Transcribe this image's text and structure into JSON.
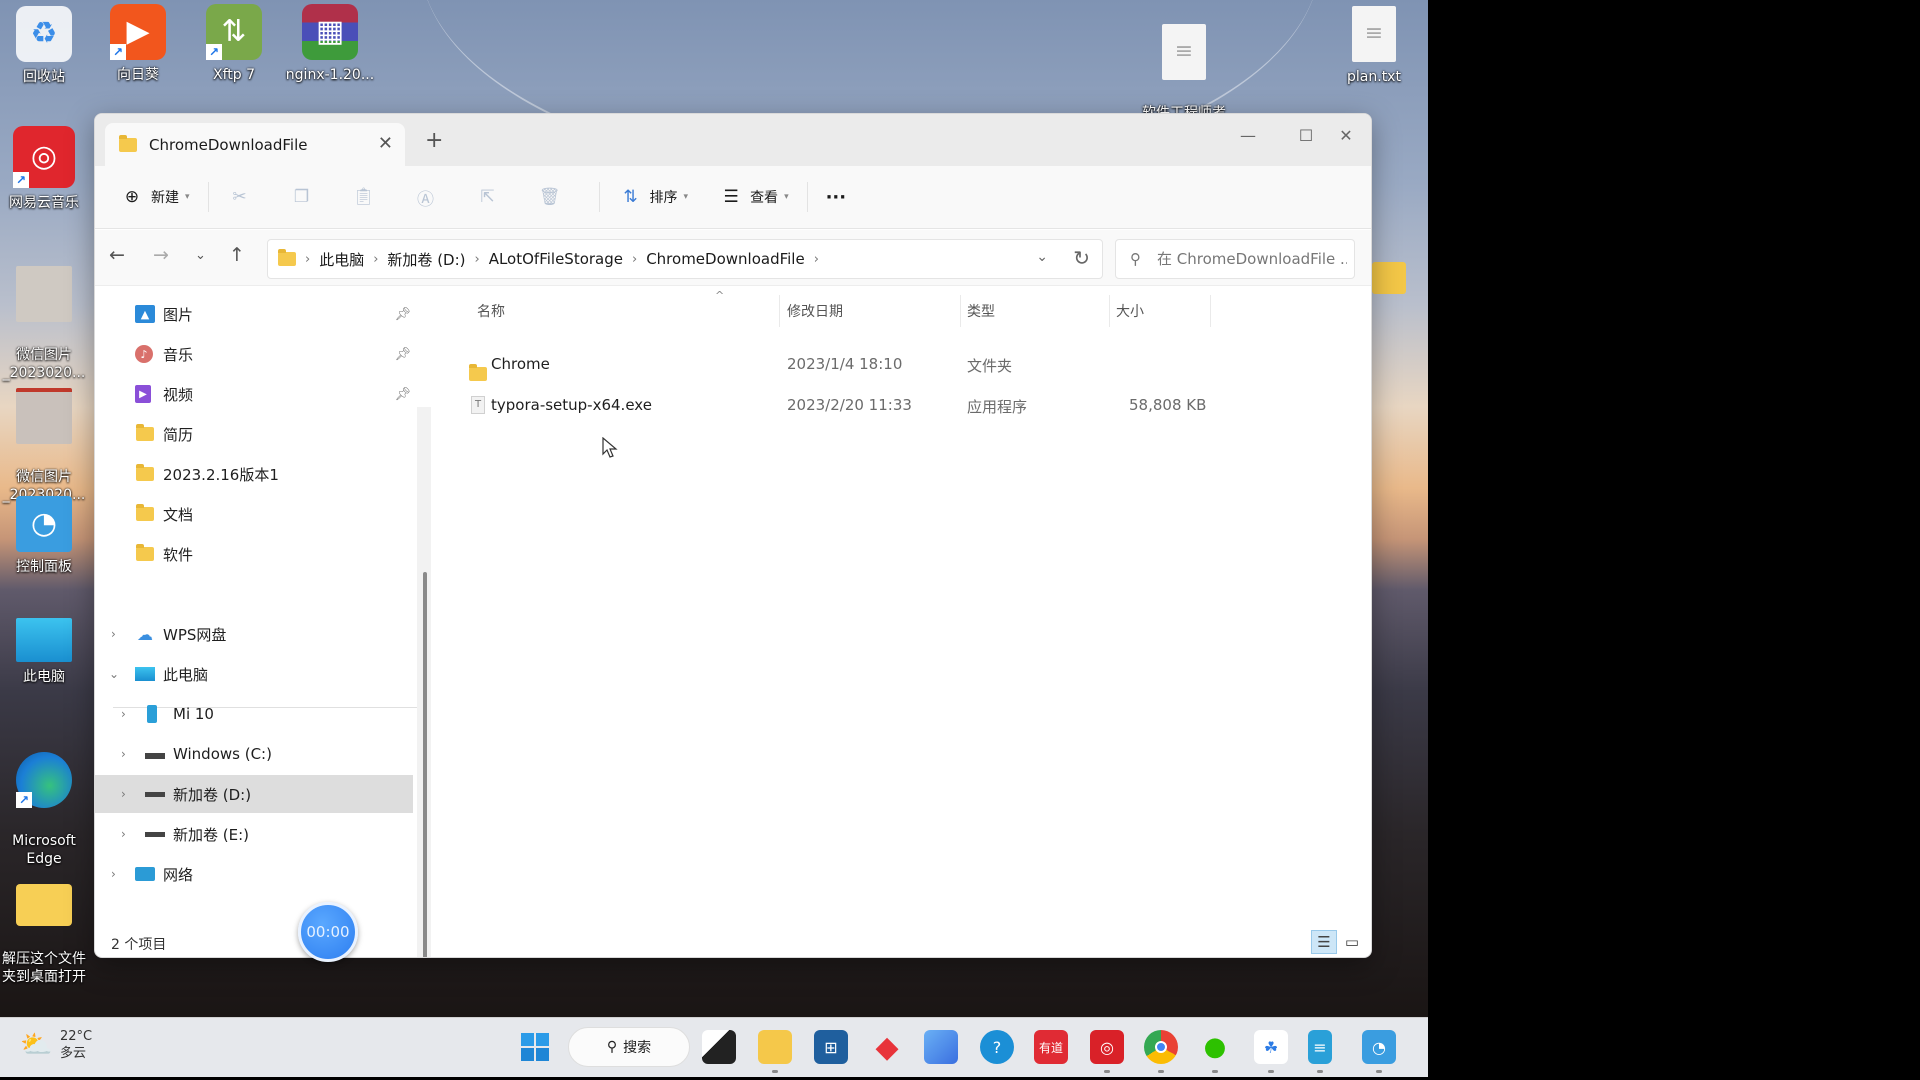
{
  "desktop": {
    "icons": [
      {
        "label": "回收站",
        "icon": "recycle-bin"
      },
      {
        "label": "向日葵",
        "icon": "sunlogin"
      },
      {
        "label": "Xftp 7",
        "icon": "xftp"
      },
      {
        "label": "nginx-1.20...",
        "icon": "winrar-archive"
      },
      {
        "label": "软件工程师考\n取证书.txt",
        "icon": "text-file"
      },
      {
        "label": "plan.txt",
        "icon": "text-file"
      },
      {
        "label": "网易云音乐",
        "icon": "netease-music"
      },
      {
        "label": "微信图片\n_2023020...",
        "icon": "image-file"
      },
      {
        "label": "微信图片\n_2023020...",
        "icon": "image-file"
      },
      {
        "label": "控制面板",
        "icon": "control-panel"
      },
      {
        "label": "此电脑",
        "icon": "this-pc"
      },
      {
        "label": "Microsoft\nEdge",
        "icon": "edge"
      },
      {
        "label": "解压这个文件\n夹到桌面打开",
        "icon": "folder"
      }
    ]
  },
  "window": {
    "tab_title": "ChromeDownloadFile",
    "new_tab": "+",
    "close_tab": "✕",
    "controls": {
      "minimize": "—",
      "maximize": "☐",
      "close": "✕"
    }
  },
  "toolbar": {
    "new_label": "新建",
    "sort_label": "排序",
    "view_label": "查看",
    "more_label": "···"
  },
  "address": {
    "crumbs": [
      "此电脑",
      "新加卷 (D:)",
      "ALotOfFileStorage",
      "ChromeDownloadFile"
    ],
    "search_placeholder": "在 ChromeDownloadFile ..."
  },
  "sidebar": {
    "quick_access": [
      {
        "label": "图片",
        "icon": "pictures",
        "pinned": true
      },
      {
        "label": "音乐",
        "icon": "music",
        "pinned": true
      },
      {
        "label": "视频",
        "icon": "videos",
        "pinned": true
      },
      {
        "label": "简历",
        "icon": "folder",
        "pinned": false
      },
      {
        "label": "2023.2.16版本1",
        "icon": "folder",
        "pinned": false
      },
      {
        "label": "文档",
        "icon": "folder",
        "pinned": false
      },
      {
        "label": "软件",
        "icon": "folder",
        "pinned": false
      }
    ],
    "tree": [
      {
        "label": "WPS网盘",
        "icon": "cloud",
        "expanded": false,
        "level": 0
      },
      {
        "label": "此电脑",
        "icon": "this-pc",
        "expanded": true,
        "level": 0
      },
      {
        "label": "Mi 10",
        "icon": "phone",
        "expanded": false,
        "level": 1
      },
      {
        "label": "Windows (C:)",
        "icon": "drive",
        "expanded": false,
        "level": 1
      },
      {
        "label": "新加卷 (D:)",
        "icon": "drive",
        "expanded": false,
        "level": 1,
        "selected": true
      },
      {
        "label": "新加卷 (E:)",
        "icon": "drive",
        "expanded": false,
        "level": 1
      },
      {
        "label": "网络",
        "icon": "network",
        "expanded": false,
        "level": 0
      }
    ]
  },
  "filelist": {
    "columns": [
      "名称",
      "修改日期",
      "类型",
      "大小"
    ],
    "rows": [
      {
        "name": "Chrome",
        "date": "2023/1/4 18:10",
        "type": "文件夹",
        "size": "",
        "icon": "folder"
      },
      {
        "name": "typora-setup-x64.exe",
        "date": "2023/2/20 11:33",
        "type": "应用程序",
        "size": "58,808 KB",
        "icon": "exe"
      }
    ]
  },
  "status": {
    "item_count": "2 个项目"
  },
  "recorder": {
    "time": "00:00"
  },
  "taskbar": {
    "weather_temp": "22°C",
    "weather_desc": "多云",
    "search_label": "搜索",
    "apps": [
      "start",
      "task-view",
      "file-explorer",
      "microsoft-store",
      "app-red-diamond",
      "app-blue-squares",
      "app-help",
      "youdao",
      "netease-music",
      "chrome",
      "wechat",
      "baidu-netdisk",
      "notepad",
      "control-panel"
    ],
    "youdao_label": "有道"
  }
}
